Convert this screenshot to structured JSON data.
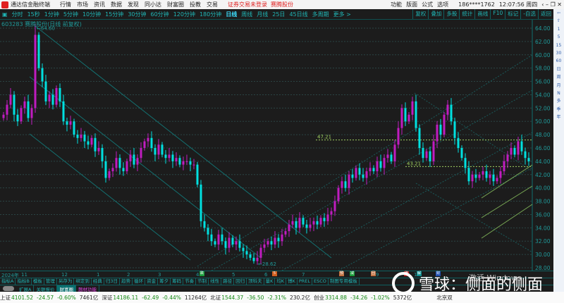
{
  "menubar": {
    "app": "通达信金融终端",
    "items": [
      "行情",
      "市场",
      "资讯",
      "数据",
      "发现",
      "同小达",
      "财富圈",
      "投教",
      "交易"
    ],
    "notice": "证券交易未登录",
    "stock_name": "赛腾股份",
    "right_items": [
      "功能",
      "版面",
      "公式",
      "选项"
    ],
    "account": "186****1762",
    "time": "12:07:56 周四"
  },
  "periods": {
    "items": [
      "分时",
      "15秒",
      "1分钟",
      "5分钟",
      "10分钟",
      "15分钟",
      "30分钟",
      "60分钟",
      "120分钟",
      "180分钟",
      "日线",
      "周线",
      "月线",
      "25日",
      "45日线",
      "多周期",
      "更多 >"
    ],
    "active": "日线"
  },
  "toolbar": [
    "复权",
    "叠加",
    "多股",
    "统计",
    "画线",
    "F10",
    "标记",
    "-自选",
    "返回"
  ],
  "chart_title": "603283 赛腾股份(日线 前复权)",
  "chart_data": {
    "type": "candlestick",
    "ylim": [
      28,
      64
    ],
    "yticks": [
      "64.00",
      "62.00",
      "60.00",
      "58.00",
      "56.00",
      "54.00",
      "52.00",
      "50.00",
      "48.00",
      "46.00",
      "44.00",
      "42.00",
      "40.00",
      "38.00",
      "36.00",
      "34.00",
      "32.00",
      "30.00",
      "28.00"
    ],
    "xticks": [
      "2024年",
      "11",
      "12",
      "1",
      "2",
      "3",
      "4",
      "5",
      "6",
      "7",
      "8",
      "9",
      "10"
    ],
    "closes": [
      51,
      52.5,
      54,
      51,
      50,
      52,
      53,
      50.5,
      52,
      63,
      58,
      56,
      53,
      54,
      52.5,
      55,
      53,
      50,
      49.5,
      50,
      48,
      47.5,
      48,
      47,
      46.5,
      47.5,
      45.5,
      46,
      44,
      41.5,
      42.5,
      43,
      44.5,
      43,
      42.5,
      44,
      45,
      43.5,
      44.5,
      46,
      47,
      47.5,
      46,
      45,
      46.5,
      45,
      44.5,
      45,
      44,
      44.5,
      43.5,
      44,
      44,
      43.5,
      43.5,
      40.5,
      35,
      34,
      33,
      32,
      31.5,
      33,
      32,
      31,
      32.5,
      31.5,
      32,
      31,
      30.5,
      30,
      29.5,
      29,
      29.5,
      31,
      31.5,
      32,
      31.5,
      32.5,
      32,
      33,
      33.5,
      34.5,
      35,
      34,
      35.5,
      34.5,
      34,
      34.5,
      35,
      34.5,
      35.5,
      35,
      36,
      36.5,
      38,
      40,
      41,
      40,
      42,
      41.5,
      43,
      42,
      41.5,
      42.5,
      43,
      42.5,
      44,
      43,
      44.5,
      45,
      44,
      46.5,
      49,
      52,
      50,
      51,
      53,
      49,
      46,
      44.5,
      45.5,
      44,
      47,
      49.5,
      48,
      51,
      52.5,
      50,
      47.5,
      46,
      44.5,
      43,
      41,
      42,
      41.5,
      42,
      42.5,
      41.5,
      42,
      41,
      41.5,
      42.5,
      44,
      45,
      46,
      45,
      47,
      45.5,
      44.5,
      44
    ],
    "high_label": "64.60",
    "low_label": "28.62",
    "hlines": [
      {
        "label": "47.21",
        "value": 47.21
      },
      {
        "label": "43.21",
        "value": 43.21
      }
    ],
    "up_color": "#c01cc0",
    "down_color": "#00e0e0"
  },
  "event_tags": [
    {
      "t": "跌",
      "c": "#1a9a3a"
    },
    {
      "t": "5",
      "c": "#d06020"
    },
    {
      "t": "预",
      "c": "#c07040"
    },
    {
      "t": "减",
      "c": "#1a9a3a"
    },
    {
      "t": "回",
      "c": "#c07040"
    },
    {
      "t": "涨",
      "c": "#c02020"
    },
    {
      "t": "解",
      "c": "#109090"
    },
    {
      "t": "财",
      "c": "#2050b0"
    }
  ],
  "indicator_tabs": [
    "指标A",
    "指标B",
    "模板",
    "管理",
    "另存为",
    "绑定到",
    "经典",
    "归3日",
    "趋势",
    "循环",
    "资金",
    "筹夕",
    "筹码",
    "节奏",
    "节制",
    "线性",
    "路径",
    "回归",
    "顶科夫",
    "量K",
    "均K",
    "博K",
    "PREL",
    "ESCO",
    "制图专用模板"
  ],
  "ext_tabs": [
    "扩展A",
    "关联报价",
    "财富圈",
    "题材功能"
  ],
  "sidebar": [
    "⇦",
    "⇧",
    "1",
    "5",
    "15",
    "30",
    "60",
    "日",
    "周",
    "月",
    "N",
    "多",
    "季",
    "年"
  ],
  "status": [
    {
      "name": "上证",
      "value": "4101.52",
      "chg": "-24.57",
      "pct": "-0.60%",
      "amt": "7461亿"
    },
    {
      "name": "深证",
      "value": "14186.11",
      "chg": "-62.49",
      "pct": "-0.44%",
      "amt": "11264亿"
    },
    {
      "name": "北证",
      "value": "1544.37",
      "chg": "-36.50",
      "pct": "-2.31%",
      "amt": "230.2亿"
    },
    {
      "name": "创业",
      "value": "3314.88",
      "chg": "-34.26",
      "pct": "-1.02%",
      "amt": "5372亿"
    }
  ],
  "status_tail": "北京双",
  "watermark": "雪球：侧面的侧面",
  "activate": "激活 Windows"
}
